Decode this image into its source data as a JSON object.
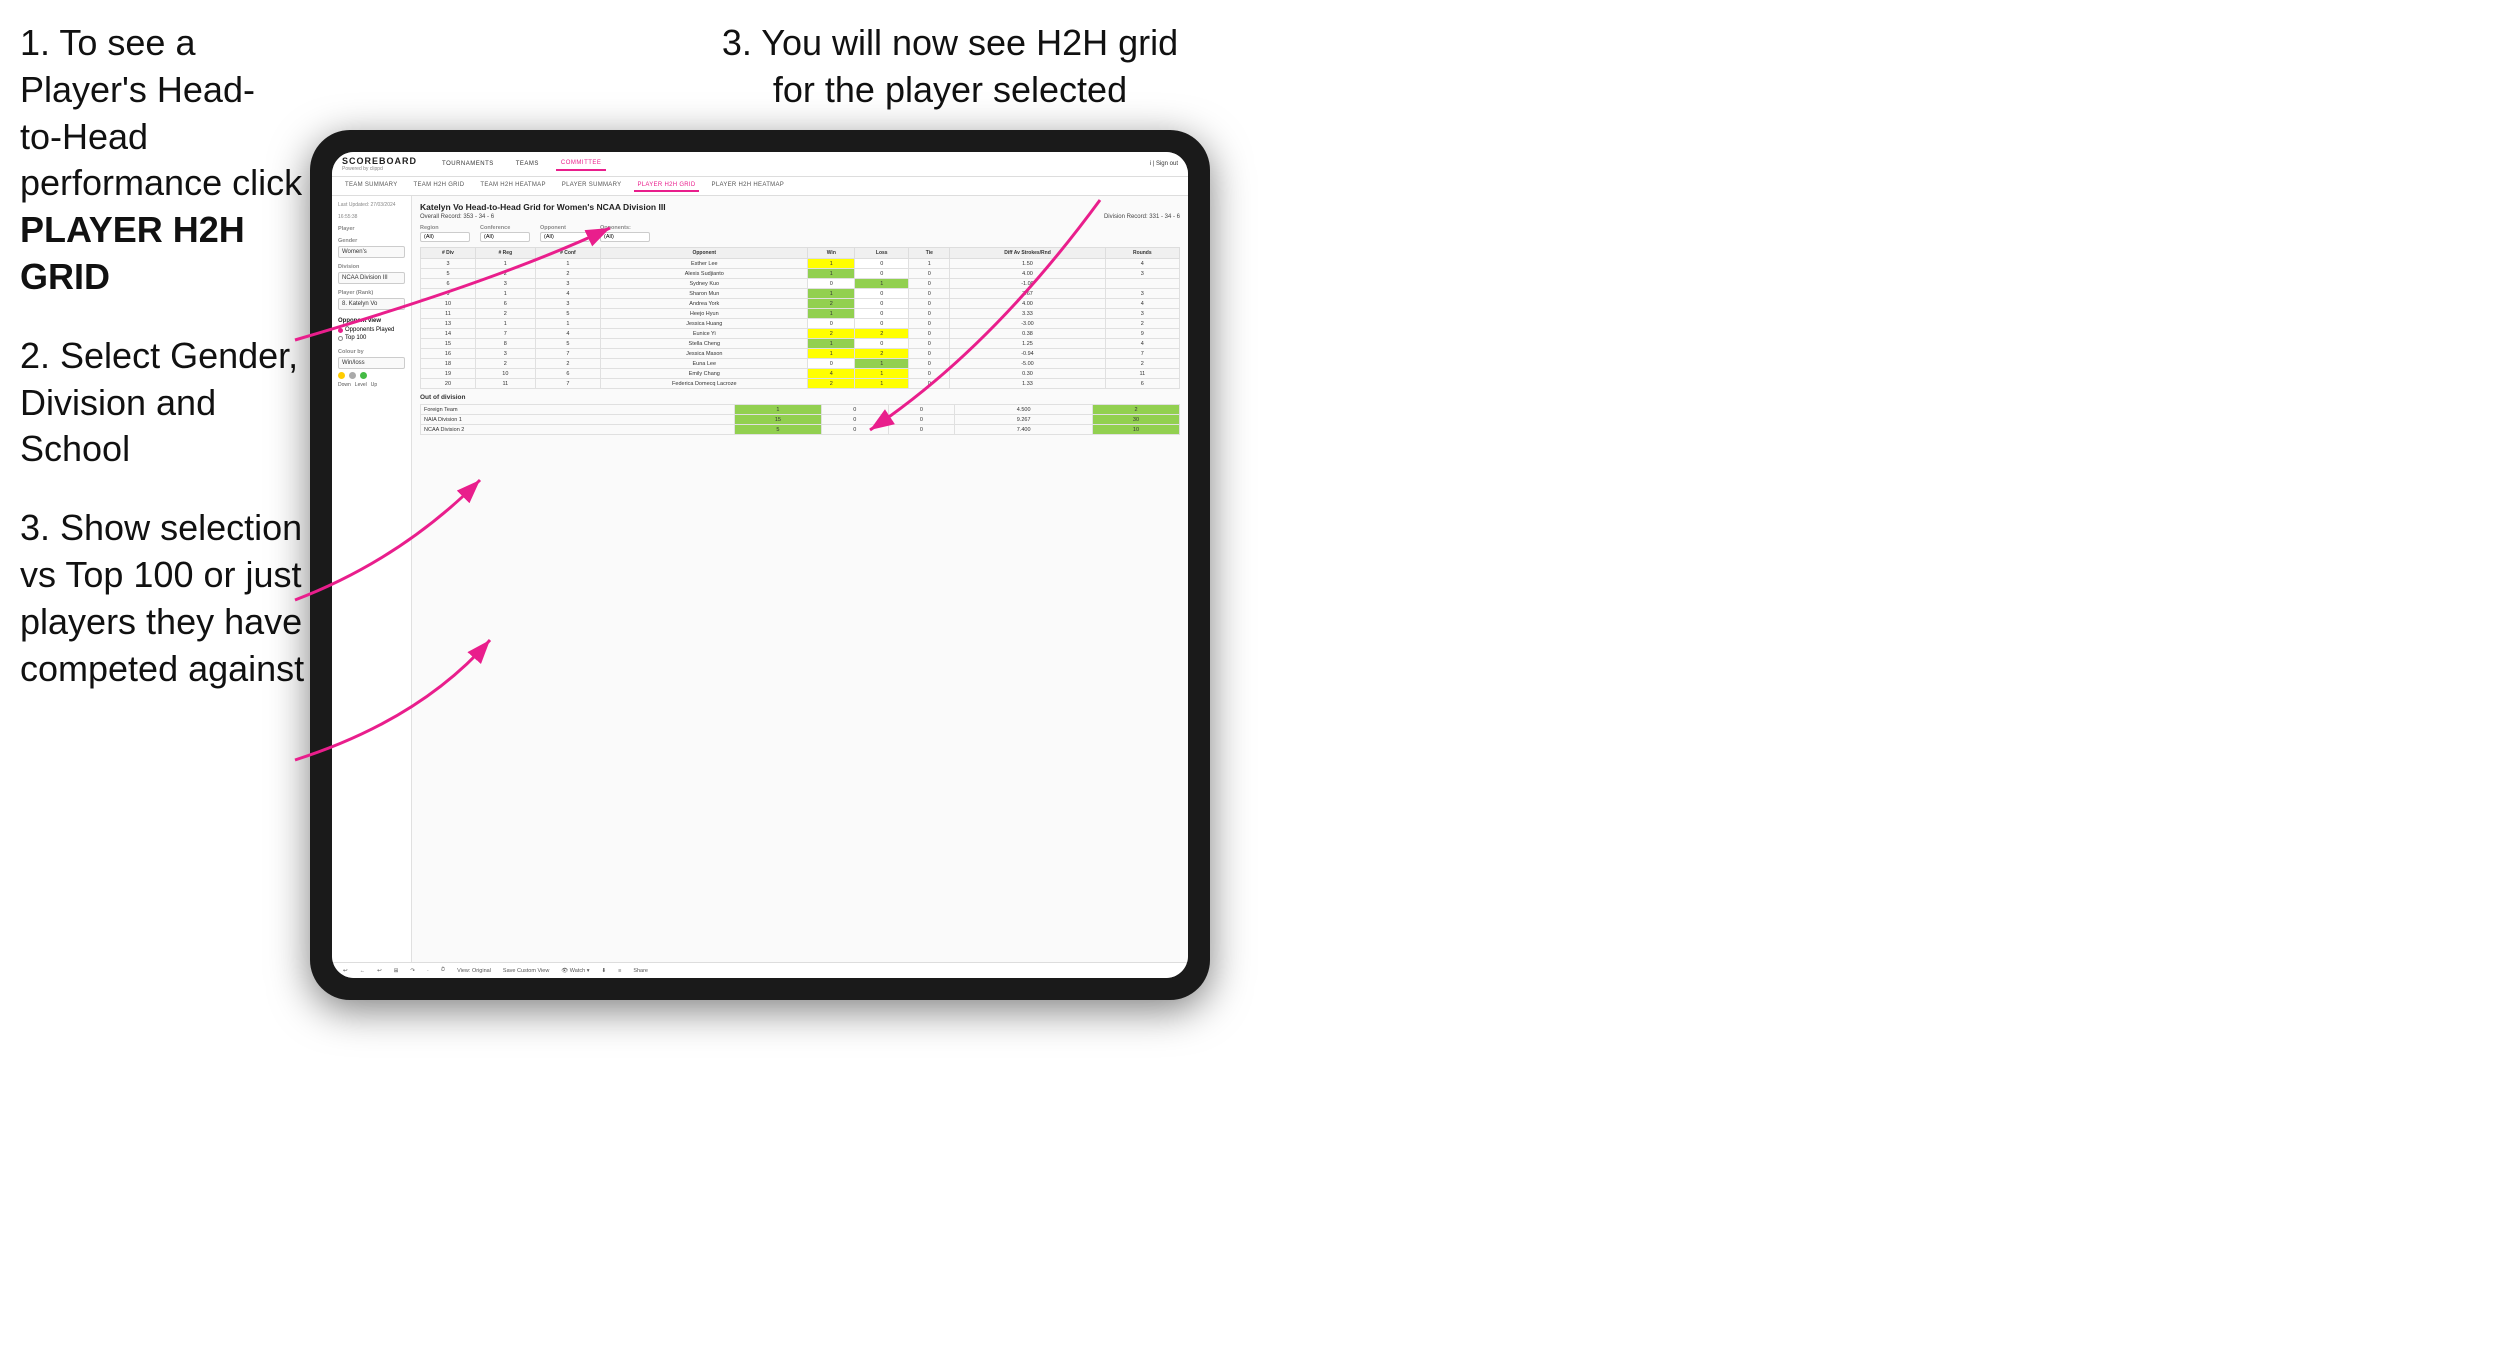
{
  "instructions": {
    "step1_line1": "1. To see a Player's Head-",
    "step1_line2": "to-Head performance click",
    "step1_bold": "PLAYER H2H GRID",
    "step2_line1": "2. Select Gender,",
    "step2_line2": "Division and",
    "step2_line3": "School",
    "step3a_line1": "3. Show selection",
    "step3a_line2": "vs Top 100 or just",
    "step3a_line3": "players they have",
    "step3a_line4": "competed against",
    "step3b_line1": "3. You will now see H2H grid",
    "step3b_line2": "for the player selected"
  },
  "nav": {
    "logo": "SCOREBOARD",
    "logo_sub": "Powered by clippd",
    "items": [
      "TOURNAMENTS",
      "TEAMS",
      "COMMITTEE"
    ],
    "sign_out": "Sign out"
  },
  "sub_nav": {
    "items": [
      "TEAM SUMMARY",
      "TEAM H2H GRID",
      "TEAM H2H HEATMAP",
      "PLAYER SUMMARY",
      "PLAYER H2H GRID",
      "PLAYER H2H HEATMAP"
    ]
  },
  "sidebar": {
    "updated": "Last Updated: 27/03/2024",
    "updated2": "16:55:38",
    "player_label": "Player",
    "gender_label": "Gender",
    "gender_value": "Women's",
    "division_label": "Division",
    "division_value": "NCAA Division III",
    "player_rank_label": "Player (Rank)",
    "player_rank_value": "8. Katelyn Vo",
    "opponent_view_label": "Opponent view",
    "radio1": "Opponents Played",
    "radio2": "Top 100",
    "colour_label": "Colour by",
    "colour_value": "Win/loss",
    "colour_down": "Down",
    "colour_level": "Level",
    "colour_up": "Up"
  },
  "main": {
    "title": "Katelyn Vo Head-to-Head Grid for Women's NCAA Division III",
    "overall_record": "Overall Record: 353 - 34 - 6",
    "division_record": "Division Record: 331 - 34 - 6",
    "filters": {
      "region_label": "Region",
      "region_value": "(All)",
      "conference_label": "Conference",
      "conference_value": "(All)",
      "opponent_label": "Opponent",
      "opponent_value": "(All)",
      "opponents_label": "Opponents:",
      "opponents_value": "(All)"
    },
    "table_headers": [
      "# Div",
      "# Reg",
      "# Conf",
      "Opponent",
      "Win",
      "Loss",
      "Tie",
      "Diff Av Strokes/Rnd",
      "Rounds"
    ],
    "rows": [
      {
        "div": "3",
        "reg": "1",
        "conf": "1",
        "opponent": "Esther Lee",
        "win": "1",
        "loss": "0",
        "tie": "1",
        "diff": "1.50",
        "rounds": "4",
        "win_color": "yellow",
        "loss_color": "white",
        "tie_color": "white"
      },
      {
        "div": "5",
        "reg": "2",
        "conf": "2",
        "opponent": "Alexis Sudjianto",
        "win": "1",
        "loss": "0",
        "tie": "0",
        "diff": "4.00",
        "rounds": "3",
        "win_color": "green",
        "loss_color": "white",
        "tie_color": "white"
      },
      {
        "div": "6",
        "reg": "3",
        "conf": "3",
        "opponent": "Sydney Kuo",
        "win": "0",
        "loss": "1",
        "tie": "0",
        "diff": "-1.00",
        "rounds": "",
        "win_color": "white",
        "loss_color": "green",
        "tie_color": "white"
      },
      {
        "div": "9",
        "reg": "1",
        "conf": "4",
        "opponent": "Sharon Mun",
        "win": "1",
        "loss": "0",
        "tie": "0",
        "diff": "3.67",
        "rounds": "3",
        "win_color": "green",
        "loss_color": "white",
        "tie_color": "white"
      },
      {
        "div": "10",
        "reg": "6",
        "conf": "3",
        "opponent": "Andrea York",
        "win": "2",
        "loss": "0",
        "tie": "0",
        "diff": "4.00",
        "rounds": "4",
        "win_color": "green",
        "loss_color": "white",
        "tie_color": "white"
      },
      {
        "div": "11",
        "reg": "2",
        "conf": "5",
        "opponent": "Heejo Hyun",
        "win": "1",
        "loss": "0",
        "tie": "0",
        "diff": "3.33",
        "rounds": "3",
        "win_color": "green",
        "loss_color": "white",
        "tie_color": "white"
      },
      {
        "div": "13",
        "reg": "1",
        "conf": "1",
        "opponent": "Jessica Huang",
        "win": "0",
        "loss": "0",
        "tie": "0",
        "diff": "-3.00",
        "rounds": "2",
        "win_color": "white",
        "loss_color": "white",
        "tie_color": "white"
      },
      {
        "div": "14",
        "reg": "7",
        "conf": "4",
        "opponent": "Eunice Yi",
        "win": "2",
        "loss": "2",
        "tie": "0",
        "diff": "0.38",
        "rounds": "9",
        "win_color": "yellow",
        "loss_color": "yellow",
        "tie_color": "white"
      },
      {
        "div": "15",
        "reg": "8",
        "conf": "5",
        "opponent": "Stella Cheng",
        "win": "1",
        "loss": "0",
        "tie": "0",
        "diff": "1.25",
        "rounds": "4",
        "win_color": "green",
        "loss_color": "white",
        "tie_color": "white"
      },
      {
        "div": "16",
        "reg": "3",
        "conf": "7",
        "opponent": "Jessica Mason",
        "win": "1",
        "loss": "2",
        "tie": "0",
        "diff": "-0.94",
        "rounds": "7",
        "win_color": "yellow",
        "loss_color": "yellow",
        "tie_color": "white"
      },
      {
        "div": "18",
        "reg": "2",
        "conf": "2",
        "opponent": "Euna Lee",
        "win": "0",
        "loss": "1",
        "tie": "0",
        "diff": "-5.00",
        "rounds": "2",
        "win_color": "white",
        "loss_color": "green",
        "tie_color": "white"
      },
      {
        "div": "19",
        "reg": "10",
        "conf": "6",
        "opponent": "Emily Chang",
        "win": "4",
        "loss": "1",
        "tie": "0",
        "diff": "0.30",
        "rounds": "11",
        "win_color": "yellow",
        "loss_color": "yellow",
        "tie_color": "white"
      },
      {
        "div": "20",
        "reg": "11",
        "conf": "7",
        "opponent": "Federica Domecq Lacroze",
        "win": "2",
        "loss": "1",
        "tie": "0",
        "diff": "1.33",
        "rounds": "6",
        "win_color": "yellow",
        "loss_color": "yellow",
        "tie_color": "white"
      }
    ],
    "out_of_division_label": "Out of division",
    "ood_rows": [
      {
        "name": "Foreign Team",
        "win": "1",
        "loss": "0",
        "tie": "0",
        "diff": "4.500",
        "rounds": "2",
        "win_color": "green"
      },
      {
        "name": "NAIA Division 1",
        "win": "15",
        "loss": "0",
        "tie": "0",
        "diff": "9.267",
        "rounds": "30",
        "win_color": "green"
      },
      {
        "name": "NCAA Division 2",
        "win": "5",
        "loss": "0",
        "tie": "0",
        "diff": "7.400",
        "rounds": "10",
        "win_color": "green"
      }
    ]
  },
  "toolbar": {
    "items": [
      "↩",
      "←",
      "↩",
      "⊞",
      "↷",
      "·",
      "⏱",
      "View: Original",
      "Save Custom View",
      "👁 Watch",
      "⬇",
      "≡",
      "Share"
    ]
  }
}
